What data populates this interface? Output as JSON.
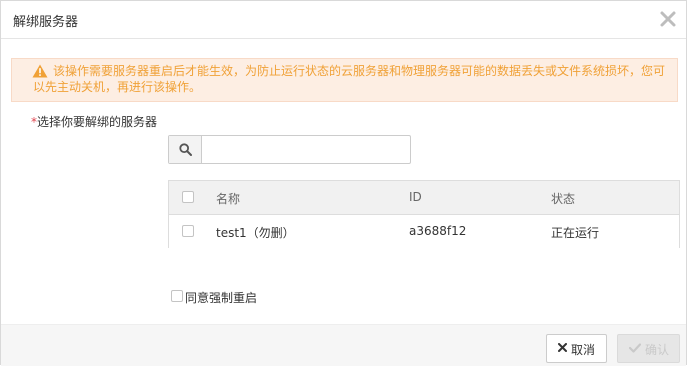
{
  "dialog": {
    "title": "解绑服务器"
  },
  "warning": {
    "text": "该操作需要服务器重启后才能生效，为防止运行状态的云服务器和物理服务器可能的数据丢失或文件系统损坏，您可以先主动关机，再进行该操作。"
  },
  "select": {
    "required_mark": "*",
    "label": "选择你要解绑的服务器"
  },
  "search": {
    "value": "",
    "placeholder": ""
  },
  "table": {
    "headers": [
      "名称",
      "ID",
      "状态"
    ],
    "rows": [
      {
        "name": "test1（勿删）",
        "id": "a3688f12",
        "status": "正在运行"
      }
    ]
  },
  "force_reboot": {
    "label": "同意强制重启"
  },
  "footer": {
    "cancel_label": "取消",
    "confirm_label": "确认"
  },
  "colors": {
    "warning_text": "#f0a137",
    "warning_bg": "#fdeee3",
    "required": "#e0454f"
  }
}
